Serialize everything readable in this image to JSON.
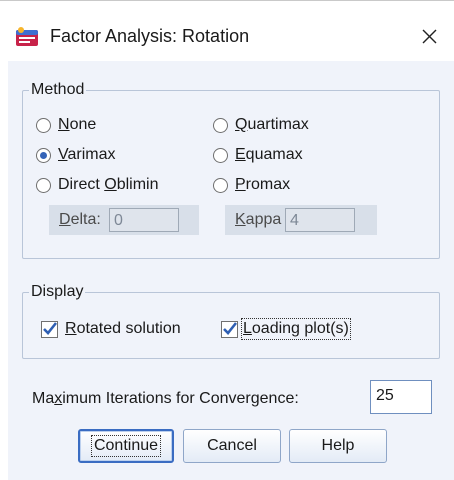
{
  "window": {
    "title": "Factor Analysis: Rotation",
    "icon": "spss-dialog-icon",
    "close_icon": "close-icon"
  },
  "method": {
    "legend": "Method",
    "options": [
      {
        "pre": "",
        "u": "N",
        "post": "one",
        "selected": false
      },
      {
        "pre": "",
        "u": "Q",
        "post": "uartimax",
        "selected": false
      },
      {
        "pre": "",
        "u": "V",
        "post": "arimax",
        "selected": true
      },
      {
        "pre": "",
        "u": "E",
        "post": "quamax",
        "selected": false
      },
      {
        "pre": "Direct ",
        "u": "O",
        "post": "blimin",
        "selected": false
      },
      {
        "pre": "",
        "u": "P",
        "post": "romax",
        "selected": false
      }
    ],
    "delta": {
      "pre": "",
      "u": "D",
      "post": "elta:",
      "value": "0"
    },
    "kappa": {
      "pre": "",
      "u": "K",
      "post": "appa",
      "value": "4"
    }
  },
  "display": {
    "legend": "Display",
    "rotated": {
      "pre": "",
      "u": "R",
      "post": "otated solution",
      "checked": true
    },
    "loading": {
      "pre": "",
      "u": "L",
      "post": "oading plot(s)",
      "checked": true
    }
  },
  "iterations": {
    "pre": "Ma",
    "u": "x",
    "post": "imum Iterations for Convergence:",
    "value": "25"
  },
  "buttons": {
    "continue": "Continue",
    "cancel": "Cancel",
    "help": "Help"
  },
  "colors": {
    "accent": "#3a6cc2",
    "dialog_bg": "#f0f3fa",
    "check": "#2f5fb3"
  }
}
